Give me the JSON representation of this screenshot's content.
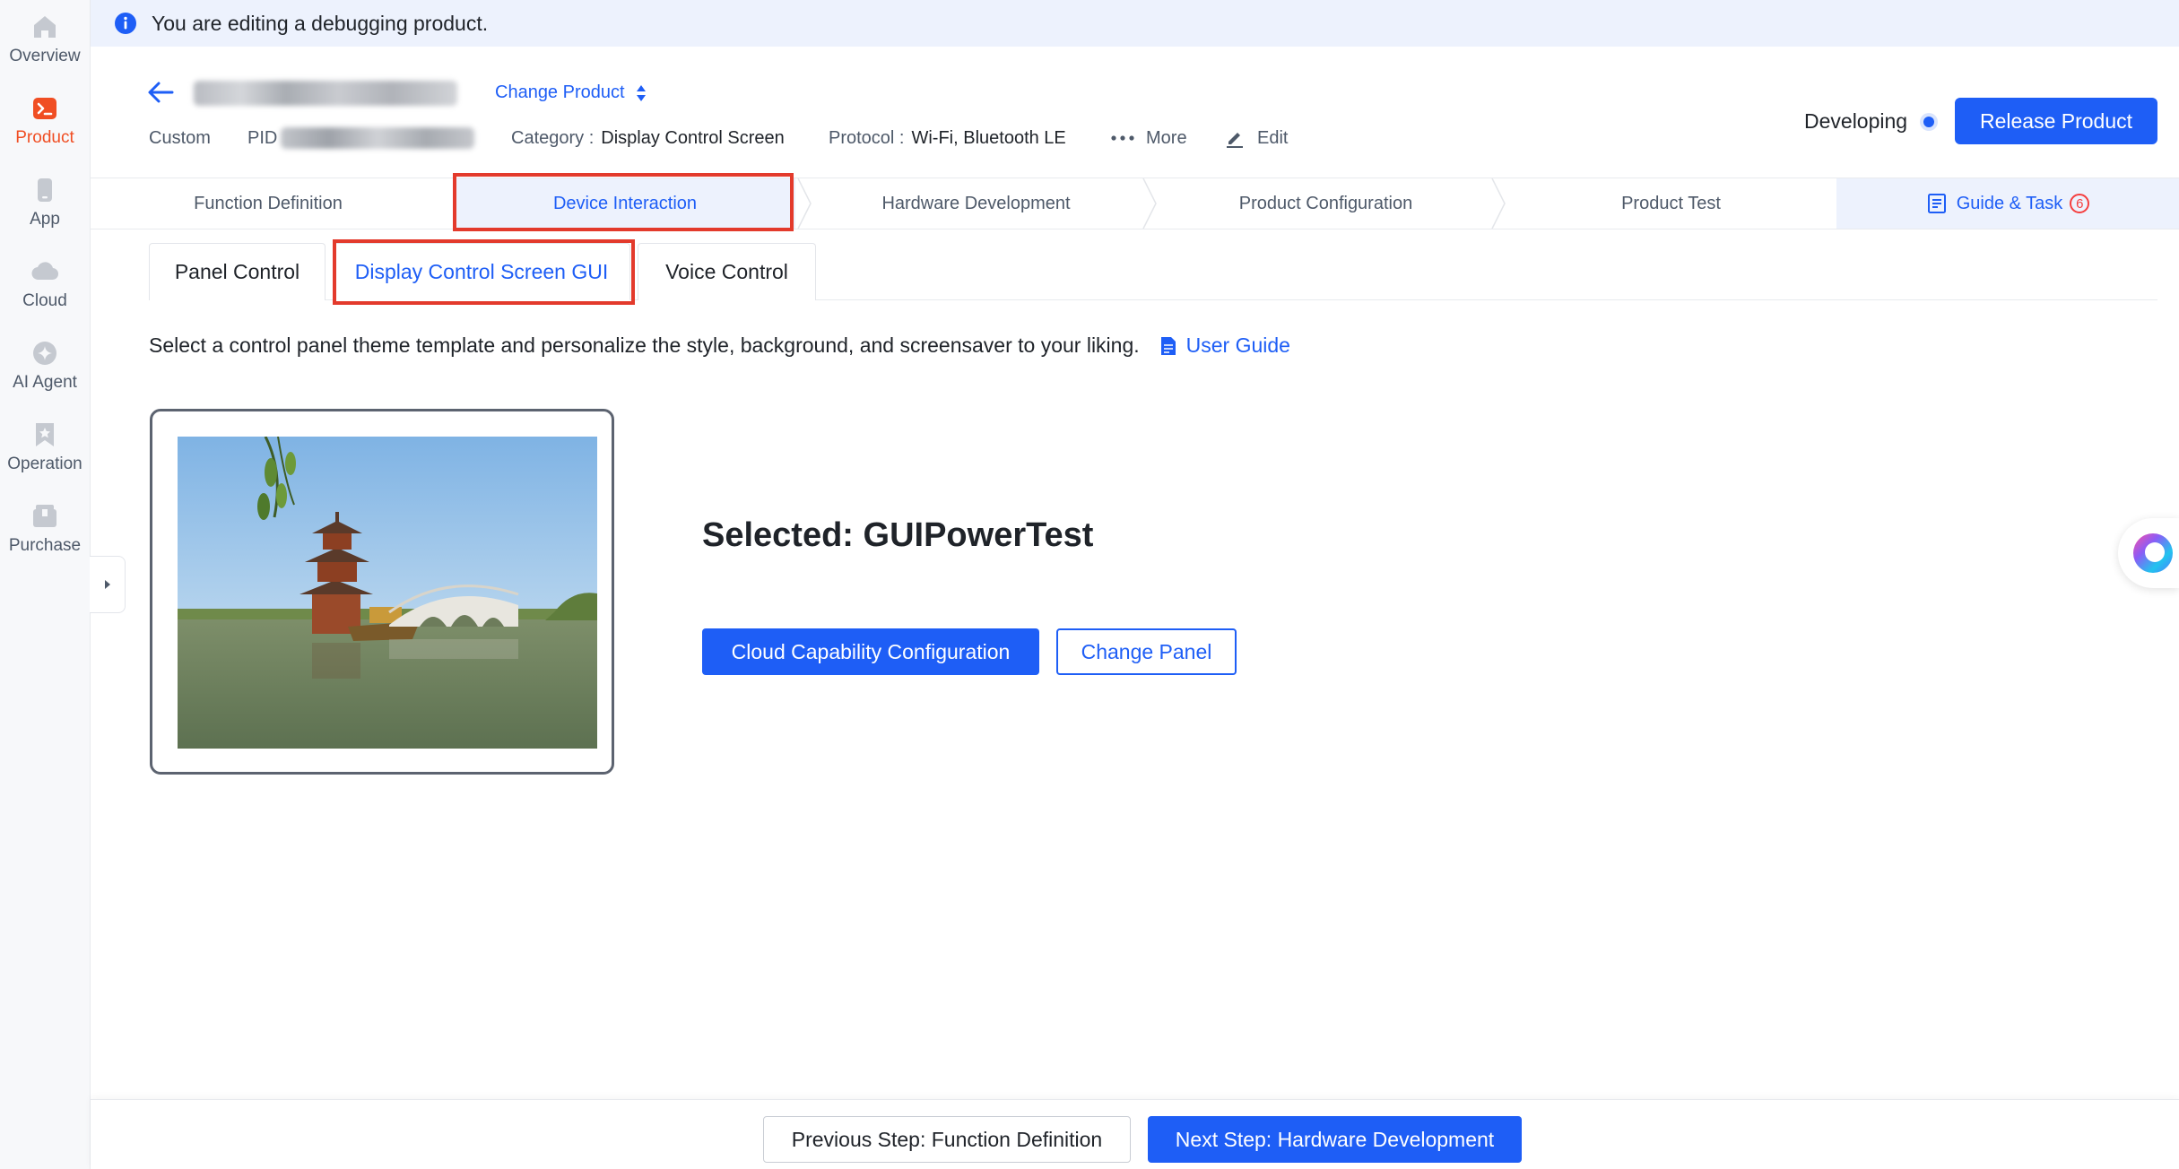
{
  "banner": {
    "text": "You are editing a debugging product."
  },
  "sidebar": {
    "items": [
      {
        "label": "Overview"
      },
      {
        "label": "Product"
      },
      {
        "label": "App"
      },
      {
        "label": "Cloud"
      },
      {
        "label": "AI Agent"
      },
      {
        "label": "Operation"
      },
      {
        "label": "Purchase"
      }
    ],
    "active": "Product"
  },
  "header": {
    "change_product": "Change Product",
    "custom": "Custom",
    "pid_label": "PID",
    "category_label": "Category :",
    "category_value": "Display Control Screen",
    "protocol_label": "Protocol :",
    "protocol_value": "Wi-Fi, Bluetooth LE",
    "more": "More",
    "edit": "Edit",
    "status": "Developing",
    "release_button": "Release Product"
  },
  "steps": {
    "items": [
      {
        "label": "Function Definition"
      },
      {
        "label": "Device Interaction"
      },
      {
        "label": "Hardware Development"
      },
      {
        "label": "Product Configuration"
      },
      {
        "label": "Product Test"
      }
    ],
    "active": "Device Interaction",
    "guide": {
      "label": "Guide & Task",
      "badge": "6"
    }
  },
  "subtabs": {
    "items": [
      {
        "label": "Panel Control"
      },
      {
        "label": "Display Control Screen GUI"
      },
      {
        "label": "Voice Control"
      }
    ],
    "active": "Display Control Screen GUI"
  },
  "content": {
    "description": "Select a control panel theme template and personalize the style, background, and screensaver to your liking.",
    "user_guide": "User Guide",
    "selected": "Selected: GUIPowerTest",
    "cloud_button": "Cloud Capability Configuration",
    "change_panel_button": "Change Panel"
  },
  "footer": {
    "prev_button": "Previous Step: Function Definition",
    "next_button": "Next Step: Hardware Development"
  },
  "colors": {
    "primary": "#1e5ef6",
    "brand_orange": "#f04e23",
    "highlight_frame": "#e33a2c",
    "banner_bg": "#edf2fd"
  },
  "icons": {
    "banner": "info-icon",
    "back": "back-arrow-icon",
    "change_product": "sort-arrows-icon",
    "more": "more-dots-icon",
    "edit": "pencil-icon",
    "guide": "list-document-icon",
    "user_guide": "document-icon",
    "assistant": "ai-assistant-icon"
  }
}
